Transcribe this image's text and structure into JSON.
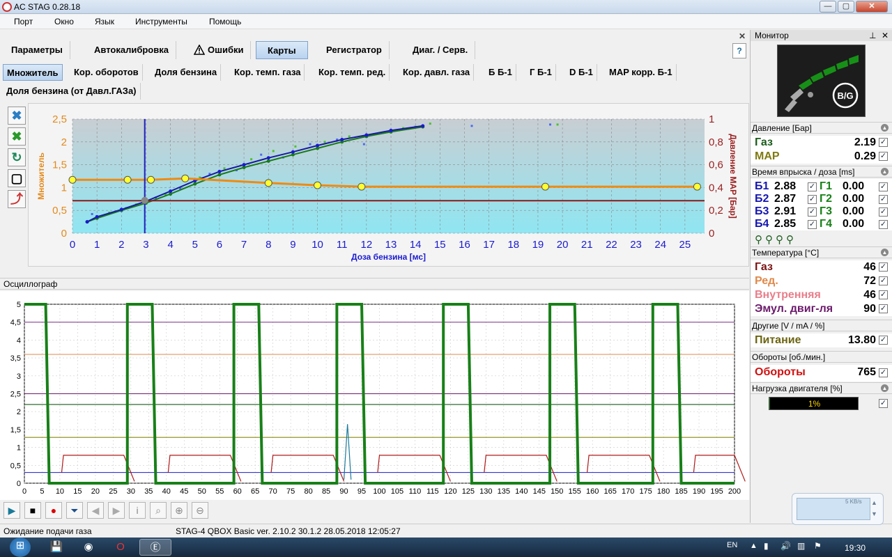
{
  "window": {
    "title": "AC STAG 0.28.18",
    "min": "—",
    "max": "▢",
    "close": "✕"
  },
  "menu": [
    "Порт",
    "Окно",
    "Язык",
    "Инструменты",
    "Помощь"
  ],
  "tabs": [
    "Параметры",
    "Автокалибровка",
    "Ошибки",
    "Карты",
    "Регистратор",
    "Диаг. / Серв."
  ],
  "subtabs_row1": [
    "Множитель",
    "Кор. оборотов",
    "Доля бензина",
    "Кор. темп. газа",
    "Кор. темп. ред.",
    "Кор. давл. газа",
    "Б Б-1",
    "Г Б-1",
    "D Б-1",
    "MAP корр. Б-1"
  ],
  "subtabs_row2": [
    "Доля бензина (от Давл.ГАЗа)"
  ],
  "icons": {
    "close": "close-icon",
    "warning": "warning-icon",
    "help": "help-icon",
    "pin": "pin-icon",
    "collapse": "collapse-icon",
    "injector": "injector-icon",
    "win-start": "windows-start-icon",
    "volume": "volume-icon",
    "battery": "battery-icon"
  },
  "map_chart": {
    "type": "scatter",
    "xlabel": "Доза бензина [мс]",
    "ylabel_left": "Множитель",
    "ylabel_right": "Давление MAP [Бар]",
    "xlim": [
      0,
      25.8
    ],
    "ylim_left": [
      0,
      2.5
    ],
    "ylim_right": [
      0,
      1
    ],
    "x_ticks": [
      0,
      1,
      2,
      3,
      4,
      5,
      6,
      7,
      8,
      9,
      10,
      11,
      12,
      13,
      14,
      15,
      16,
      17,
      18,
      19,
      20,
      21,
      22,
      23,
      24,
      25
    ],
    "y_ticks_left": [
      "0",
      "0,5",
      "1",
      "1,5",
      "2",
      "2,5"
    ],
    "y_ticks_right": [
      "0",
      "0,2",
      "0,4",
      "0,6",
      "0,8",
      "1"
    ],
    "cursor_x": 2.95,
    "map_line": 0.285,
    "multiplier_points": [
      [
        0,
        1.17
      ],
      [
        2.25,
        1.17
      ],
      [
        3.2,
        1.17
      ],
      [
        4.6,
        1.2
      ],
      [
        8,
        1.1
      ],
      [
        10,
        1.05
      ],
      [
        11.8,
        1.02
      ],
      [
        19.3,
        1.02
      ],
      [
        25.5,
        1.02
      ]
    ],
    "blue_curve": [
      [
        0.6,
        0.25
      ],
      [
        1,
        0.36
      ],
      [
        2,
        0.52
      ],
      [
        3,
        0.7
      ],
      [
        4,
        0.92
      ],
      [
        5,
        1.15
      ],
      [
        6,
        1.35
      ],
      [
        7,
        1.5
      ],
      [
        8,
        1.65
      ],
      [
        9,
        1.78
      ],
      [
        10,
        1.92
      ],
      [
        11,
        2.05
      ],
      [
        12,
        2.15
      ],
      [
        13,
        2.25
      ],
      [
        14.3,
        2.35
      ]
    ],
    "green_curve": [
      [
        0.6,
        0.25
      ],
      [
        1,
        0.33
      ],
      [
        2,
        0.5
      ],
      [
        3,
        0.66
      ],
      [
        4,
        0.86
      ],
      [
        5,
        1.08
      ],
      [
        6,
        1.28
      ],
      [
        7,
        1.44
      ],
      [
        8,
        1.58
      ],
      [
        9,
        1.72
      ],
      [
        10,
        1.86
      ],
      [
        11,
        2
      ],
      [
        12,
        2.12
      ],
      [
        13,
        2.22
      ],
      [
        14.3,
        2.33
      ]
    ],
    "scatter": [
      [
        0.8,
        0.42
      ],
      [
        1.5,
        0.45
      ],
      [
        2.2,
        0.55
      ],
      [
        2.6,
        0.63
      ],
      [
        3.4,
        0.78
      ],
      [
        3.8,
        0.85
      ],
      [
        4.4,
        0.98
      ],
      [
        5.2,
        1.22
      ],
      [
        5.6,
        1.3
      ],
      [
        6.2,
        1.42
      ],
      [
        6.7,
        1.38
      ],
      [
        7.3,
        1.62
      ],
      [
        7.7,
        1.72
      ],
      [
        8.2,
        1.8
      ],
      [
        8.6,
        1.66
      ],
      [
        9.1,
        1.9
      ],
      [
        9.7,
        1.95
      ],
      [
        10.3,
        2
      ],
      [
        10.8,
        2.05
      ],
      [
        11.3,
        2.12
      ],
      [
        11.9,
        1.95
      ],
      [
        12.4,
        2.18
      ],
      [
        12.9,
        2.22
      ],
      [
        13.5,
        2.3
      ],
      [
        14,
        2.33
      ],
      [
        14.6,
        2.4
      ],
      [
        16.3,
        2.35
      ],
      [
        19.8,
        2.38
      ],
      [
        19.5,
        2.38
      ]
    ]
  },
  "osc_chart": {
    "type": "line",
    "xlim": [
      0,
      200
    ],
    "ylim": [
      0,
      5
    ],
    "x_ticks": [
      "0",
      "5",
      "10",
      "15",
      "20",
      "25",
      "30",
      "35",
      "40",
      "45",
      "50",
      "55",
      "60",
      "65",
      "70",
      "75",
      "80",
      "85",
      "90",
      "95",
      "100",
      "105",
      "110",
      "115",
      "120",
      "125",
      "130",
      "135",
      "140",
      "145",
      "150",
      "155",
      "160",
      "165",
      "170",
      "175",
      "180",
      "185",
      "190",
      "195",
      "200"
    ],
    "y_ticks": [
      "0",
      "0,5",
      "1",
      "1,5",
      "2",
      "2,5",
      "3",
      "3,5",
      "4",
      "4,5",
      "5"
    ],
    "pulse_highs": [
      [
        0,
        6
      ],
      [
        29,
        36
      ],
      [
        59,
        66
      ],
      [
        88,
        95
      ],
      [
        118,
        125
      ],
      [
        148,
        155
      ],
      [
        177,
        184
      ]
    ],
    "levels": {
      "purple": 4.5,
      "orange": 3.6,
      "purple2": 2.5,
      "dark_green": 2.2,
      "olive": 1.28,
      "blue": 0.3
    },
    "red_pulses": [
      [
        11,
        28
      ],
      [
        41,
        58
      ],
      [
        70,
        87
      ],
      [
        100,
        117
      ],
      [
        130,
        147
      ],
      [
        159,
        176
      ],
      [
        189,
        200
      ]
    ],
    "red_level": 0.78,
    "spike_x": 91,
    "spike_y": 1.65
  },
  "osc_title": "Осциллограф",
  "osc_tool_icons": [
    "play-icon",
    "stop-icon",
    "record-icon",
    "down-icon",
    "prev-icon",
    "next-icon",
    "info-icon",
    "zoom-icon",
    "zoom-in-icon",
    "zoom-out-icon"
  ],
  "status": {
    "left": "Ожидание подачи газа",
    "right": "STAG-4 QBOX Basic  ver. 2.10.2  30.1.2   28.05.2018 12:05:27"
  },
  "monitor": {
    "title": "Монитор",
    "logo_text": "B/G",
    "pressure": {
      "title": "Давление [Бар]",
      "gas_label": "Газ",
      "gas_val": "2.19",
      "map_label": "MAP",
      "map_val": "0.29"
    },
    "injection": {
      "title": "Время впрыска / доза [ms]",
      "rows": [
        {
          "b": "Б1",
          "bv": "2.88",
          "g": "Г1",
          "gv": "0.00"
        },
        {
          "b": "Б2",
          "bv": "2.87",
          "g": "Г2",
          "gv": "0.00"
        },
        {
          "b": "Б3",
          "bv": "2.91",
          "g": "Г3",
          "gv": "0.00"
        },
        {
          "b": "Б4",
          "bv": "2.85",
          "g": "Г4",
          "gv": "0.00"
        }
      ]
    },
    "temperature": {
      "title": "Температура [°C]",
      "rows": [
        {
          "label": "Газ",
          "val": "46",
          "color": "#7a1212"
        },
        {
          "label": "Ред.",
          "val": "72",
          "color": "#e0894a"
        },
        {
          "label": "Внутренняя",
          "val": "46",
          "color": "#e87e8a"
        },
        {
          "label": "Эмул. двиг-ля",
          "val": "90",
          "color": "#6b1a6b"
        }
      ]
    },
    "other": {
      "title": "Другие [V / mA / %]",
      "label": "Питание",
      "val": "13.80"
    },
    "rpm": {
      "title": "Обороты [об./мин.]",
      "label": "Обороты",
      "val": "765"
    },
    "load": {
      "title": "Нагрузка двигателя [%]",
      "text": "1%",
      "value": 1
    }
  },
  "net": {
    "speed": "5 KB/s"
  },
  "taskbar": {
    "lang": "EN",
    "clock": "19:30"
  }
}
